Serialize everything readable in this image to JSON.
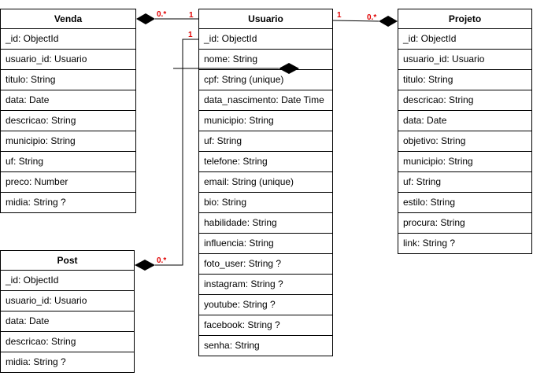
{
  "entities": {
    "venda": {
      "title": "Venda",
      "fields": [
        "_id: ObjectId",
        "usuario_id: Usuario",
        "titulo: String",
        "data: Date",
        "descricao: String",
        "municipio: String",
        "uf: String",
        "preco: Number",
        "midia: String ?"
      ]
    },
    "usuario": {
      "title": "Usuario",
      "fields": [
        "_id: ObjectId",
        "nome: String",
        "cpf: String (unique)",
        "data_nascimento: Date Time",
        "municipio: String",
        "uf: String",
        "telefone: String",
        "email: String (unique)",
        "bio: String",
        "habilidade: String",
        "influencia: String",
        "foto_user: String ?",
        "instagram: String ?",
        "youtube: String ?",
        "facebook: String ?",
        "senha: String"
      ]
    },
    "projeto": {
      "title": "Projeto",
      "fields": [
        "_id: ObjectId",
        "usuario_id: Usuario",
        "titulo: String",
        "descricao: String",
        "data: Date",
        "objetivo: String",
        "municipio: String",
        "uf: String",
        "estilo: String",
        "procura: String",
        "link: String ?"
      ]
    },
    "post": {
      "title": "Post",
      "fields": [
        "_id: ObjectId",
        "usuario_id: Usuario",
        "data: Date",
        "descricao: String",
        "midia: String ?"
      ]
    }
  },
  "relationships": {
    "venda_usuario": {
      "many": "0..*",
      "one": "1"
    },
    "usuario_projeto": {
      "one": "1",
      "many": "0..*"
    },
    "usuario_post": {
      "one": "1",
      "many": "0..*"
    }
  },
  "colors": {
    "multiplicity": "#e00000",
    "line": "#000000"
  }
}
